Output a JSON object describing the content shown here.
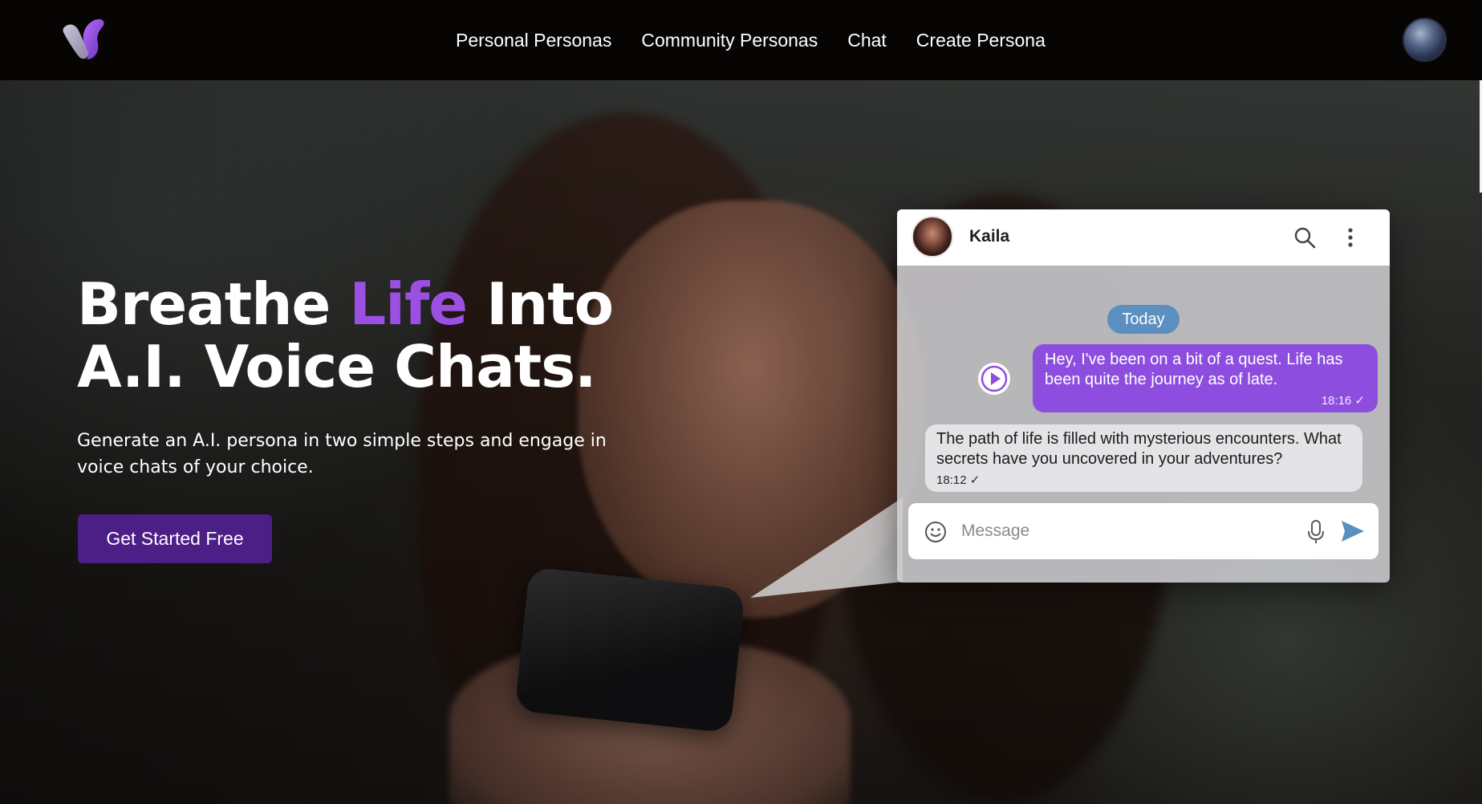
{
  "nav": {
    "items": [
      "Personal Personas",
      "Community Personas",
      "Chat",
      "Create Persona"
    ]
  },
  "hero": {
    "title_part1": "Breathe ",
    "title_accent": "Life",
    "title_part2": " Into",
    "title_line2": "A.I. Voice Chats.",
    "subtitle": "Generate an A.I. persona in two simple steps and engage in voice chats of your choice.",
    "cta_label": "Get Started Free"
  },
  "chat": {
    "contact_name": "Kaila",
    "day_label": "Today",
    "messages": [
      {
        "direction": "out",
        "text": "Hey, I've been on a bit of a quest. Life has been quite the journey as of late.",
        "time": "18:16 ✓"
      },
      {
        "direction": "in",
        "text": "The path of life is filled with mysterious encounters. What secrets have you uncovered in your adventures?",
        "time": "18:12 ✓"
      }
    ],
    "composer_placeholder": "Message"
  },
  "colors": {
    "accent": "#9b4fe3",
    "cta": "#4c1f86",
    "outgoing_bubble": "#8d4ee0",
    "day_pill": "#5b8fbf",
    "send_icon": "#5b8fbf"
  },
  "icons": [
    "logo-mark",
    "user-avatar",
    "contact-avatar",
    "search-icon",
    "more-vertical-icon",
    "play-icon",
    "emoji-icon",
    "mic-icon",
    "send-icon"
  ]
}
